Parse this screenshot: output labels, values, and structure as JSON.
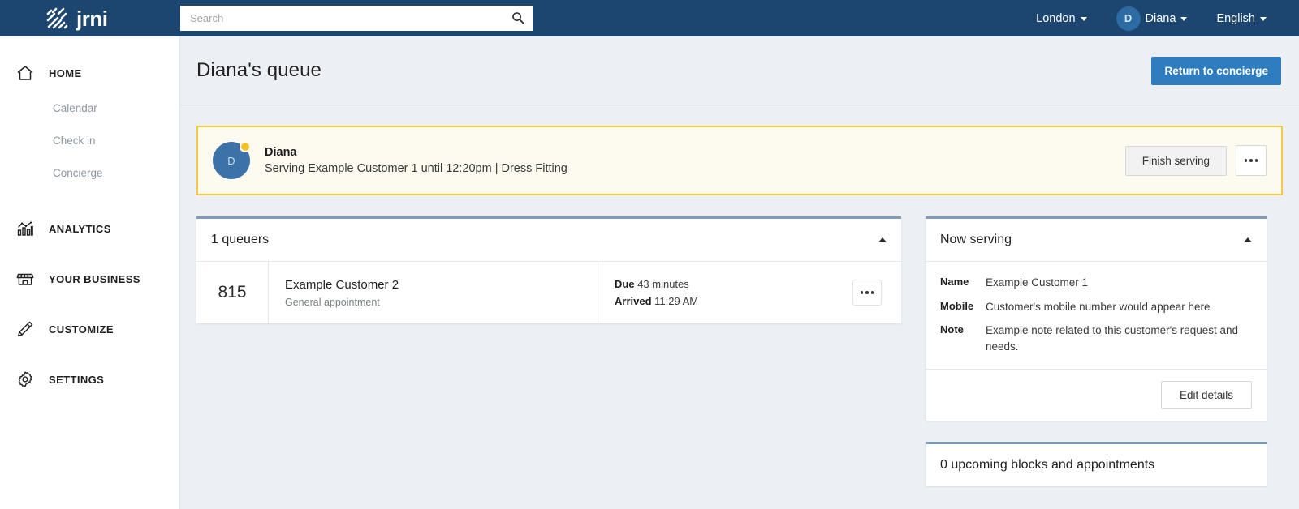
{
  "topbar": {
    "brand": "jrni",
    "brand_icon": "jrni-logo-icon",
    "search_placeholder": "Search",
    "search_value": "",
    "search_icon": "search-icon",
    "location": "London",
    "user_initial": "D",
    "user_name": "Diana",
    "language": "English"
  },
  "sidebar": {
    "groups": [
      {
        "label": "HOME",
        "icon": "home-icon",
        "sub": [
          "Calendar",
          "Check in",
          "Concierge"
        ]
      },
      {
        "label": "ANALYTICS",
        "icon": "analytics-icon",
        "sub": []
      },
      {
        "label": "YOUR BUSINESS",
        "icon": "store-icon",
        "sub": []
      },
      {
        "label": "CUSTOMIZE",
        "icon": "pencil-icon",
        "sub": []
      },
      {
        "label": "SETTINGS",
        "icon": "gear-icon",
        "sub": []
      }
    ]
  },
  "page": {
    "title": "Diana's queue",
    "return_button": "Return to concierge"
  },
  "serving_banner": {
    "avatar_initial": "D",
    "name": "Diana",
    "description": "Serving Example Customer 1 until 12:20pm | Dress Fitting",
    "finish_button": "Finish serving",
    "more_icon": "ellipsis-icon",
    "border_color": "#f5c842",
    "background_color": "#fdfbef"
  },
  "queuers_card": {
    "title": "1 queuers",
    "collapse_icon": "caret-up-icon",
    "rows": [
      {
        "number": "815",
        "name": "Example Customer 2",
        "appointment": "General appointment",
        "due_label": "Due",
        "due_value": "43 minutes",
        "arrived_label": "Arrived",
        "arrived_value": "11:29 AM",
        "more_icon": "ellipsis-icon"
      }
    ]
  },
  "now_serving_card": {
    "title": "Now serving",
    "collapse_icon": "caret-up-icon",
    "details": [
      {
        "label": "Name",
        "value": "Example Customer 1"
      },
      {
        "label": "Mobile",
        "value": "Customer's mobile number would appear here"
      },
      {
        "label": "Note",
        "value": "Example note related to this customer's request and needs."
      }
    ],
    "edit_button": "Edit details"
  },
  "upcoming_card": {
    "title": "0 upcoming blocks and appointments"
  },
  "colors": {
    "topbar": "#1c456f",
    "primary_button": "#2f7cbf",
    "card_top_border": "#7f9cbb",
    "page_background": "#eceff3"
  }
}
